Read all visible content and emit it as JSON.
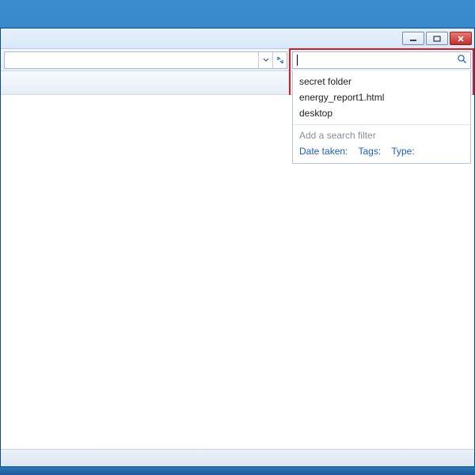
{
  "search": {
    "value": "",
    "placeholder": ""
  },
  "dropdown": {
    "history": [
      "secret folder",
      "energy_report1.html",
      "desktop"
    ],
    "filter_hint": "Add a search filter",
    "filters": [
      "Date taken:",
      "Tags:",
      "Type:"
    ]
  }
}
